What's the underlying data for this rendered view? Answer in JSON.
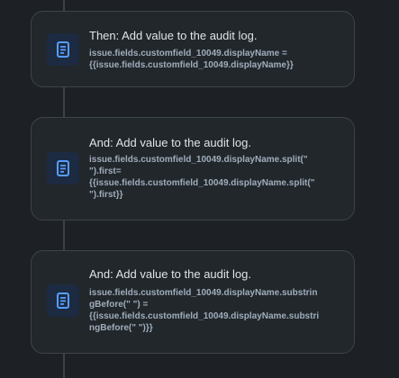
{
  "colors": {
    "background": "#1d2125",
    "card_background": "#22272b",
    "card_border": "#3d444b",
    "connector": "#3b4249",
    "icon_tile": "#1c2b41",
    "icon_accent": "#579dff",
    "title_text": "#dee4ea",
    "detail_text": "#9fadbc"
  },
  "actions": [
    {
      "icon": "document-log-icon",
      "title": "Then: Add value to the audit log.",
      "detail": "issue.fields.customfield_10049.displayName =\n{{issue.fields.customfield_10049.displayName}}"
    },
    {
      "icon": "document-log-icon",
      "title": "And: Add value to the audit log.",
      "detail": "issue.fields.customfield_10049.displayName.split(\"\n\").first=\n{{issue.fields.customfield_10049.displayName.split(\"\n\").first}}"
    },
    {
      "icon": "document-log-icon",
      "title": "And: Add value to the audit log.",
      "detail": "issue.fields.customfield_10049.displayName.substrin\ngBefore(\" \") =\n{{issue.fields.customfield_10049.displayName.substri\nngBefore(\" \")}}"
    }
  ]
}
